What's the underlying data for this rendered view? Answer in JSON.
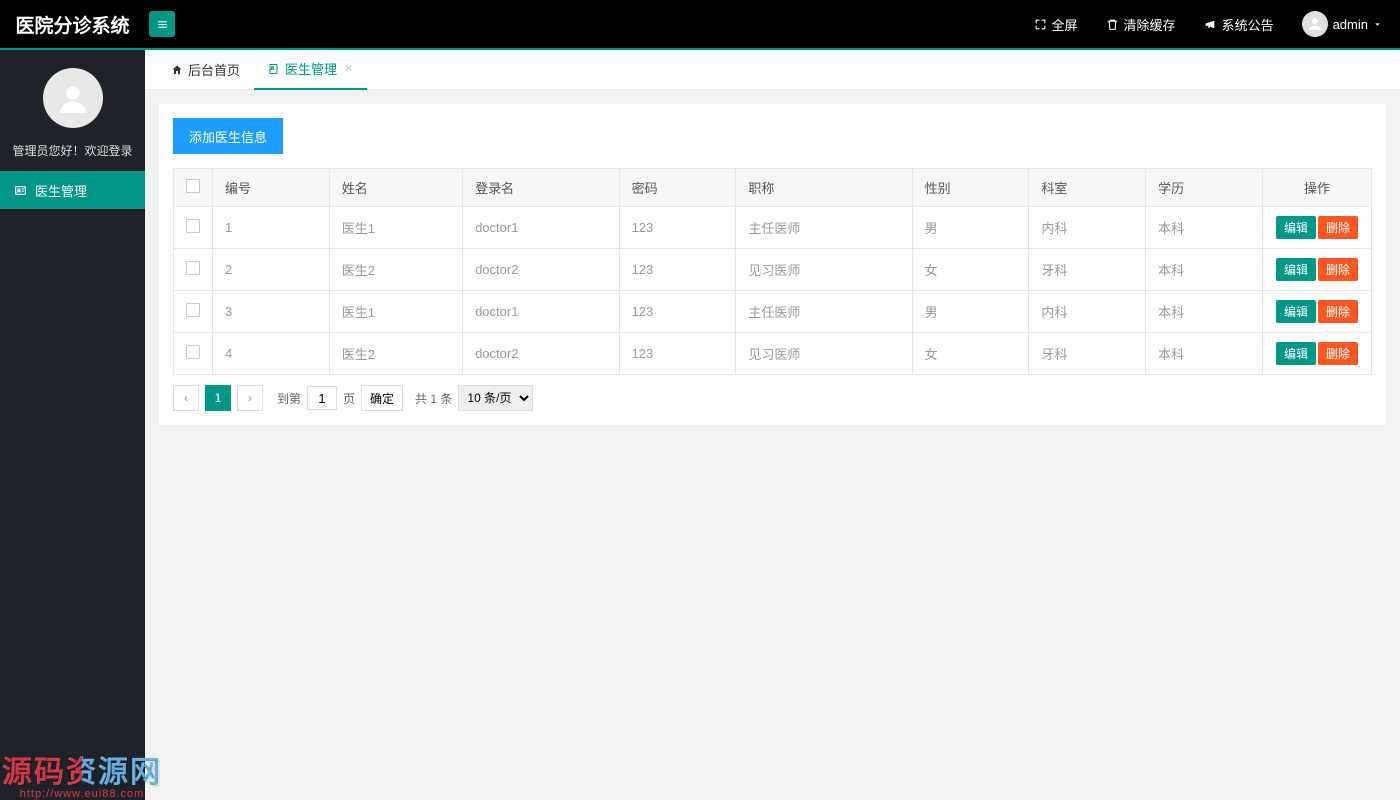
{
  "app": {
    "title": "医院分诊系统"
  },
  "header": {
    "fullscreen": "全屏",
    "clearCache": "清除缓存",
    "announce": "系统公告",
    "user": "admin"
  },
  "sidebar": {
    "welcome": "管理员您好！欢迎登录",
    "items": [
      {
        "label": "医生管理",
        "active": true
      }
    ]
  },
  "tabs": [
    {
      "label": "后台首页",
      "icon": "home",
      "closable": false,
      "active": false
    },
    {
      "label": "医生管理",
      "icon": "file",
      "closable": true,
      "active": true
    }
  ],
  "actions": {
    "add": "添加医生信息",
    "edit": "编辑",
    "delete": "删除"
  },
  "table": {
    "columns": [
      "编号",
      "姓名",
      "登录名",
      "密码",
      "职称",
      "性别",
      "科室",
      "学历",
      "操作"
    ],
    "rows": [
      {
        "id": "1",
        "name": "医生1",
        "login": "doctor1",
        "pwd": "123",
        "title": "主任医师",
        "gender": "男",
        "dept": "内科",
        "edu": "本科"
      },
      {
        "id": "2",
        "name": "医生2",
        "login": "doctor2",
        "pwd": "123",
        "title": "见习医师",
        "gender": "女",
        "dept": "牙科",
        "edu": "本科"
      },
      {
        "id": "3",
        "name": "医生1",
        "login": "doctor1",
        "pwd": "123",
        "title": "主任医师",
        "gender": "男",
        "dept": "内科",
        "edu": "本科"
      },
      {
        "id": "4",
        "name": "医生2",
        "login": "doctor2",
        "pwd": "123",
        "title": "见习医师",
        "gender": "女",
        "dept": "牙科",
        "edu": "本科"
      }
    ]
  },
  "pagination": {
    "current": "1",
    "gotoLabel": "到第",
    "pageSuffix": "页",
    "gotoValue": "1",
    "confirm": "确定",
    "total": "共 1 条",
    "perPage": "10 条/页"
  },
  "watermark": {
    "line1": "源码资源网",
    "line2": "http://www.eui88.com"
  }
}
